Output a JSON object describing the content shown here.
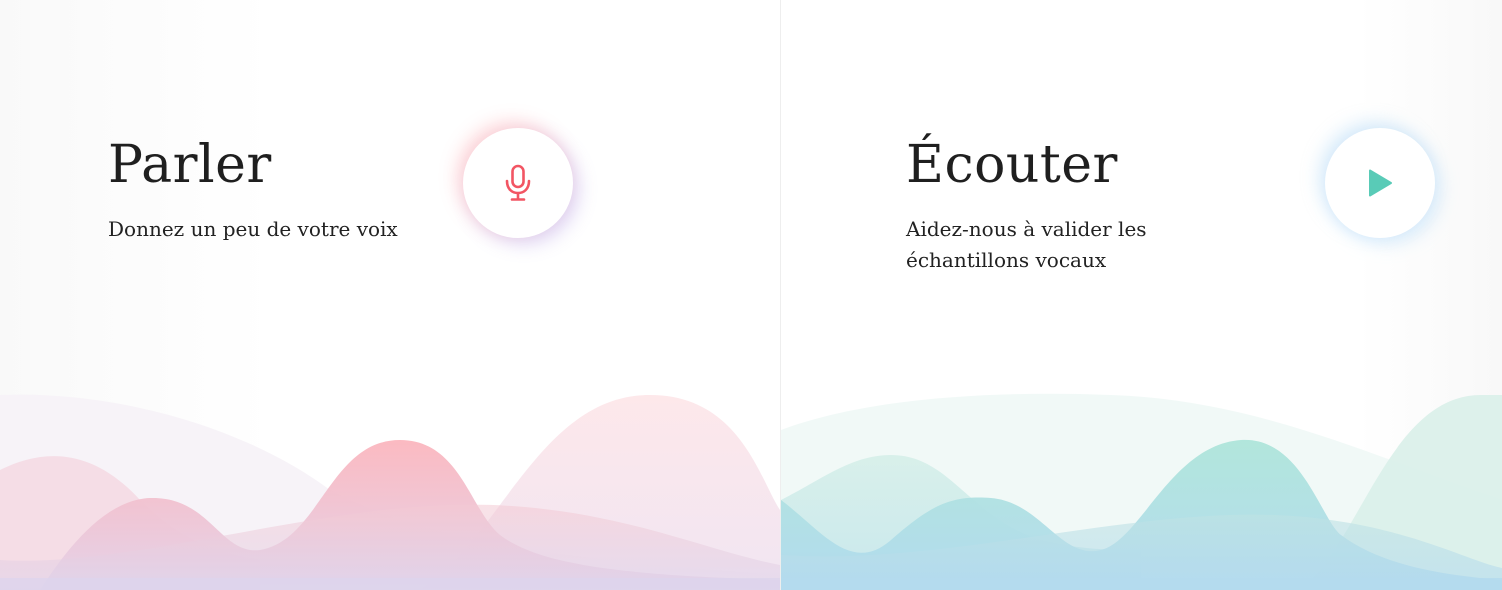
{
  "speak": {
    "title": "Parler",
    "subtitle": "Donnez un peu de votre voix",
    "button_icon": "microphone-icon",
    "icon_color": "#f25563"
  },
  "listen": {
    "title": "Écouter",
    "subtitle": "Aidez-nous à valider les échantillons vocaux",
    "button_icon": "play-icon",
    "icon_color": "#59cbb7"
  },
  "colors": {
    "speak_wave_primary": "#fbb8c0",
    "speak_wave_secondary": "#dcd2ec",
    "listen_wave_primary": "#a9e3d8",
    "listen_wave_secondary": "#b3dbef"
  }
}
